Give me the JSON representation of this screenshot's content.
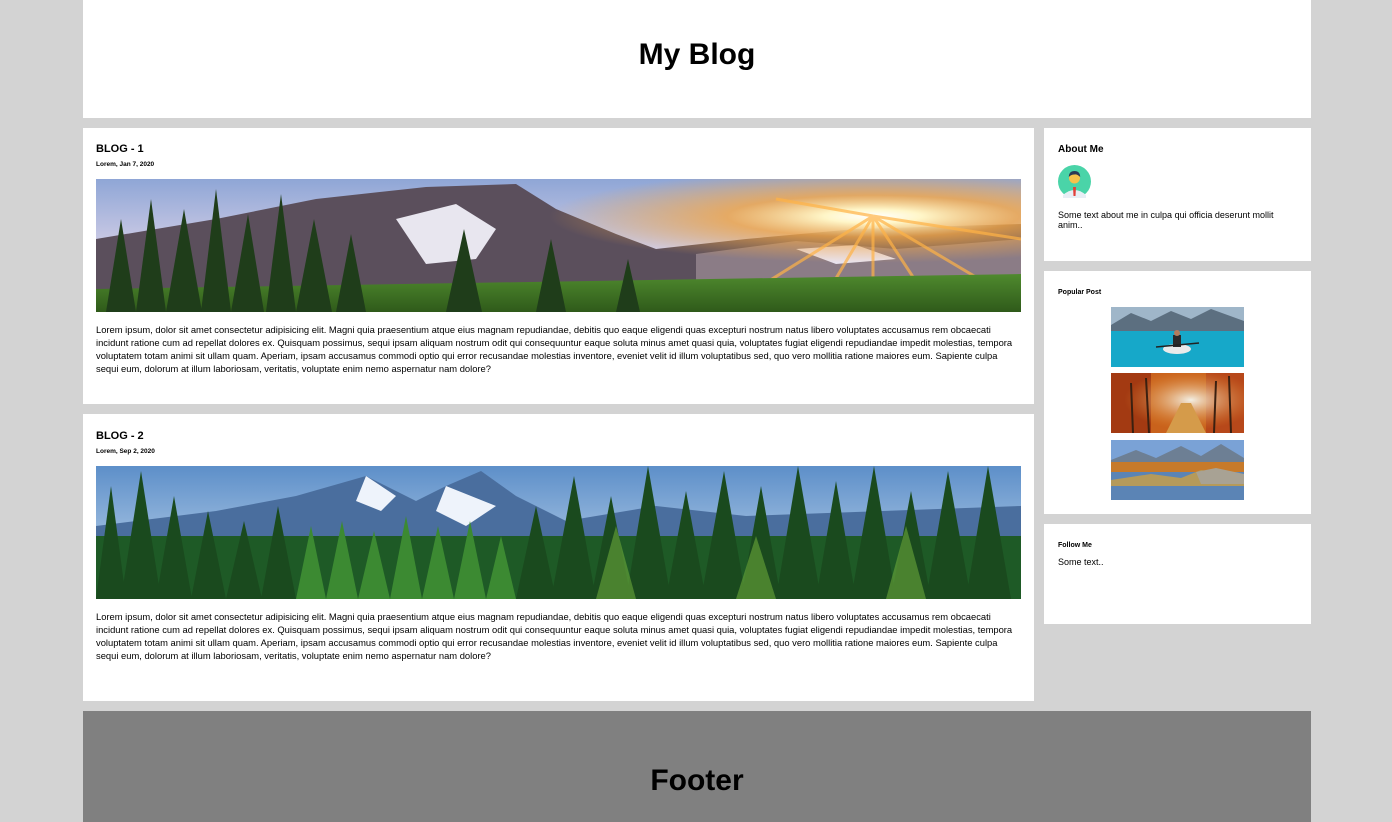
{
  "header": {
    "title": "My Blog"
  },
  "posts": [
    {
      "title": "BLOG - 1",
      "date": "Lorem, Jan 7, 2020",
      "image": "mountain-sunset-photo",
      "text": "Lorem ipsum, dolor sit amet consectetur adipisicing elit. Magni quia praesentium atque eius magnam repudiandae, debitis quo eaque eligendi quas excepturi nostrum natus libero voluptates accusamus rem obcaecati incidunt ratione cum ad repellat dolores ex. Quisquam possimus, sequi ipsam aliquam nostrum odit qui consequuntur eaque soluta minus amet quasi quia, voluptates fugiat eligendi repudiandae impedit molestias, tempora voluptatem totam animi sit ullam quam. Aperiam, ipsam accusamus commodi optio qui error recusandae molestias inventore, eveniet velit id illum voluptatibus sed, quo vero mollitia ratione maiores eum. Sapiente culpa sequi eum, dolorum at illum laboriosam, veritatis, voluptate enim nemo aspernatur nam dolore?"
    },
    {
      "title": "BLOG - 2",
      "date": "Lorem, Sep 2, 2020",
      "image": "pine-forest-mountains-photo",
      "text": "Lorem ipsum, dolor sit amet consectetur adipisicing elit. Magni quia praesentium atque eius magnam repudiandae, debitis quo eaque eligendi quas excepturi nostrum natus libero voluptates accusamus rem obcaecati incidunt ratione cum ad repellat dolores ex. Quisquam possimus, sequi ipsam aliquam nostrum odit qui consequuntur eaque soluta minus amet quasi quia, voluptates fugiat eligendi repudiandae impedit molestias, tempora voluptatem totam animi sit ullam quam. Aperiam, ipsam accusamus commodi optio qui error recusandae molestias inventore, eveniet velit id illum voluptatibus sed, quo vero mollitia ratione maiores eum. Sapiente culpa sequi eum, dolorum at illum laboriosam, veritatis, voluptate enim nemo aspernatur nam dolore?"
    }
  ],
  "sidebar": {
    "about": {
      "heading": "About Me",
      "avatar": "user-avatar-icon",
      "text": "Some text about me in culpa qui officia deserunt mollit anim.."
    },
    "popular": {
      "heading": "Popular Post",
      "thumbs": [
        "kayak-lake-photo",
        "autumn-forest-photo",
        "mountain-lake-photo"
      ]
    },
    "follow": {
      "heading": "Follow Me",
      "text": "Some text.."
    }
  },
  "footer": {
    "title": "Footer"
  },
  "colors": {
    "background": "#d3d3d3",
    "card": "#ffffff",
    "footer": "#808080",
    "avatar_bg": "#4ad4a8"
  }
}
